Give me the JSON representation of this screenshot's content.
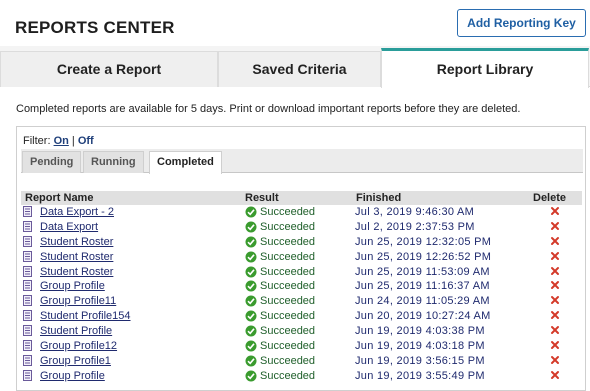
{
  "header": {
    "title": "REPORTS CENTER",
    "add_key_label": "Add Reporting Key"
  },
  "tabs": [
    {
      "label": "Create a Report",
      "active": false
    },
    {
      "label": "Saved Criteria",
      "active": false
    },
    {
      "label": "Report Library",
      "active": true
    }
  ],
  "notice": "Completed reports are available for 5 days. Print or download important reports before they are deleted.",
  "filter": {
    "label": "Filter:",
    "on": "On",
    "separator": "|",
    "off": "Off"
  },
  "subtabs": [
    {
      "label": "Pending",
      "active": false
    },
    {
      "label": "Running",
      "active": false
    },
    {
      "label": "Completed",
      "active": true
    }
  ],
  "table": {
    "headers": {
      "name": "Report Name",
      "result": "Result",
      "finished": "Finished",
      "delete": "Delete"
    },
    "rows": [
      {
        "name": "Data Export - 2",
        "result": "Succeeded",
        "finished": "Jul 3, 2019 9:46:30 AM"
      },
      {
        "name": "Data Export",
        "result": "Succeeded",
        "finished": "Jul 2, 2019 2:37:53 PM"
      },
      {
        "name": "Student Roster",
        "result": "Succeeded",
        "finished": "Jun 25, 2019 12:32:05 PM"
      },
      {
        "name": "Student Roster",
        "result": "Succeeded",
        "finished": "Jun 25, 2019 12:26:52 PM"
      },
      {
        "name": "Student Roster",
        "result": "Succeeded",
        "finished": "Jun 25, 2019 11:53:09 AM"
      },
      {
        "name": "Group Profile",
        "result": "Succeeded",
        "finished": "Jun 25, 2019 11:16:37 AM"
      },
      {
        "name": "Group Profile11",
        "result": "Succeeded",
        "finished": "Jun 24, 2019 11:05:29 AM"
      },
      {
        "name": "Student Profile154",
        "result": "Succeeded",
        "finished": "Jun 20, 2019 10:27:24 AM"
      },
      {
        "name": "Student Profile",
        "result": "Succeeded",
        "finished": "Jun 19, 2019 4:03:38 PM"
      },
      {
        "name": "Group Profile12",
        "result": "Succeeded",
        "finished": "Jun 19, 2019 4:03:18 PM"
      },
      {
        "name": "Group Profile1",
        "result": "Succeeded",
        "finished": "Jun 19, 2019 3:56:15 PM"
      },
      {
        "name": "Group Profile",
        "result": "Succeeded",
        "finished": "Jun 19, 2019 3:55:49 PM"
      }
    ]
  },
  "colors": {
    "accent_teal": "#2a9d9a",
    "button_blue": "#2a6db1",
    "success_green": "#3a9b2e",
    "delete_red": "#d43a2a",
    "link_navy": "#1f2a6e"
  },
  "icons": {
    "report": "report-file-icon",
    "success": "check-circle-icon",
    "delete": "delete-x-icon"
  }
}
